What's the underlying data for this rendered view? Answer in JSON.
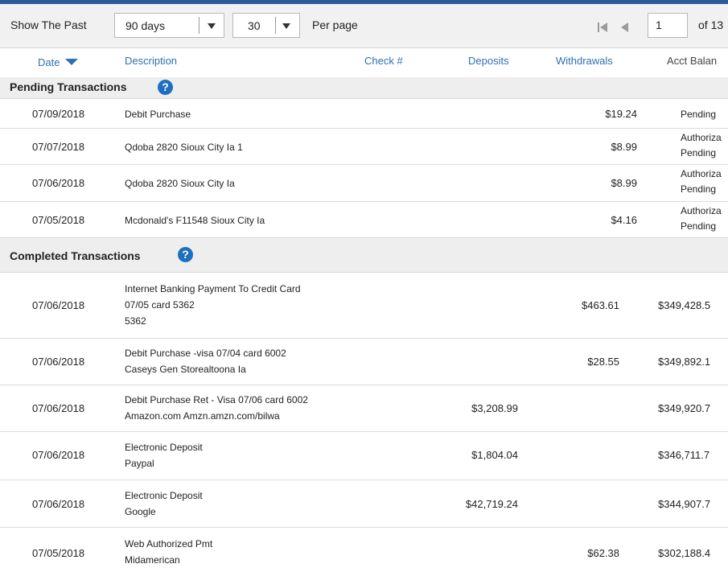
{
  "toolbar": {
    "show_label": "Show The Past",
    "range_value": "90 days",
    "per_page_value": "30",
    "per_page_label": "Per page",
    "page_number": "1",
    "page_of": "of 13"
  },
  "columns": {
    "date": "Date",
    "description": "Description",
    "check": "Check #",
    "deposits": "Deposits",
    "withdrawals": "Withdrawals",
    "balance": "Acct Balan"
  },
  "pending": {
    "title": "Pending Transactions",
    "rows": [
      {
        "date": "07/09/2018",
        "description": "Debit Purchase",
        "withdrawal": "$19.24",
        "status1": "Pending",
        "status2": ""
      },
      {
        "date": "07/07/2018",
        "description": "Qdoba 2820 Sioux City Ia 1",
        "withdrawal": "$8.99",
        "status1": "Authoriza",
        "status2": "Pending"
      },
      {
        "date": "07/06/2018",
        "description": "Qdoba 2820 Sioux City Ia",
        "withdrawal": "$8.99",
        "status1": "Authoriza",
        "status2": "Pending"
      },
      {
        "date": "07/05/2018",
        "description": "Mcdonald's F11548 Sioux City Ia",
        "withdrawal": "$4.16",
        "status1": "Authoriza",
        "status2": "Pending"
      }
    ]
  },
  "completed": {
    "title": "Completed Transactions",
    "rows": [
      {
        "date": "07/06/2018",
        "desc1": "Internet Banking Payment To Credit Card",
        "desc2": "07/05 card 5362",
        "desc3": "5362",
        "deposit": "",
        "withdrawal": "$463.61",
        "balance": "$349,428.5"
      },
      {
        "date": "07/06/2018",
        "desc1": "Debit Purchase -visa 07/04 card 6002",
        "desc2": "Caseys Gen Storealtoona Ia",
        "desc3": "",
        "deposit": "",
        "withdrawal": "$28.55",
        "balance": "$349,892.1"
      },
      {
        "date": "07/06/2018",
        "desc1": "Debit Purchase Ret - Visa 07/06 card 6002",
        "desc2": "Amazon.com Amzn.amzn.com/bilwa",
        "desc3": "",
        "deposit": "$3,208.99",
        "withdrawal": "",
        "balance": "$349,920.7"
      },
      {
        "date": "07/06/2018",
        "desc1": "Electronic Deposit",
        "desc2": "Paypal",
        "desc3": "",
        "deposit": "$1,804.04",
        "withdrawal": "",
        "balance": "$346,711.7"
      },
      {
        "date": "07/06/2018",
        "desc1": "Electronic Deposit",
        "desc2": "Google",
        "desc3": "",
        "deposit": "$42,719.24",
        "withdrawal": "",
        "balance": "$344,907.7"
      },
      {
        "date": "07/05/2018",
        "desc1": "Web Authorized Pmt",
        "desc2": "Midamerican",
        "desc3": "",
        "deposit": "",
        "withdrawal": "$62.38",
        "balance": "$302,188.4"
      }
    ]
  }
}
